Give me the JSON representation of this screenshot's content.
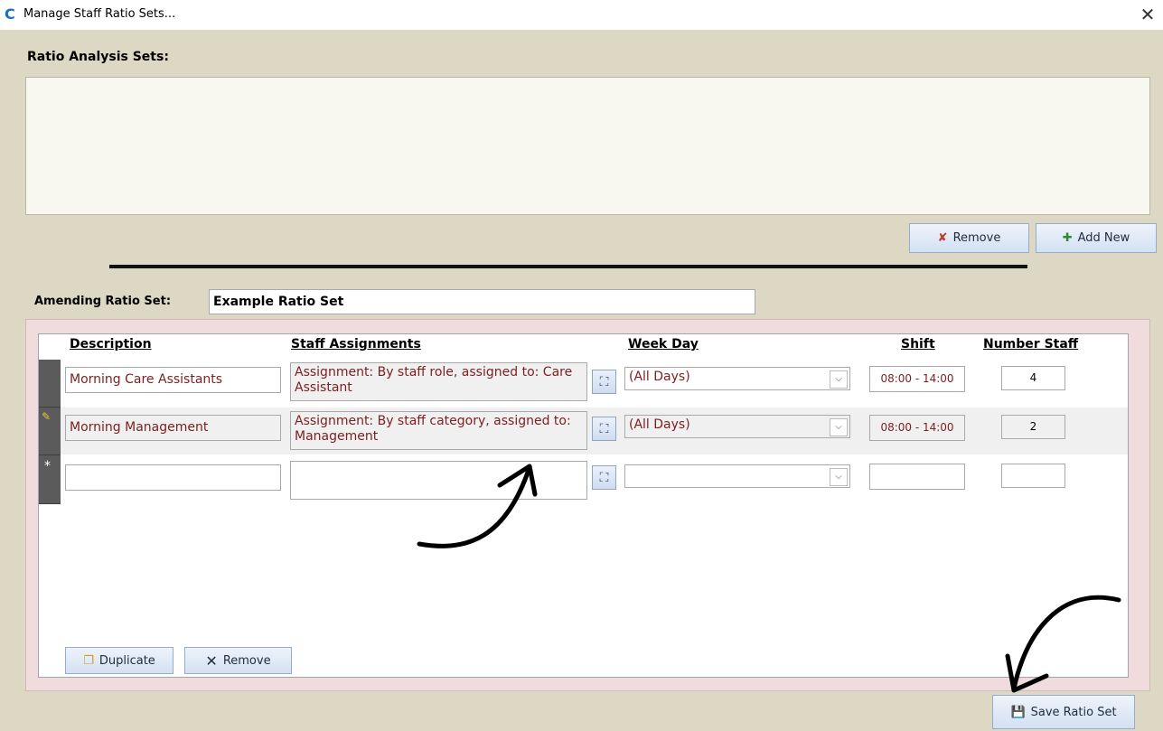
{
  "window": {
    "logo_text": "C",
    "title": "Manage Staff Ratio Sets...",
    "close_symbol": "✕"
  },
  "sets": {
    "label": "Ratio Analysis Sets:",
    "remove_label": "Remove",
    "add_label": "Add New"
  },
  "amending": {
    "label": "Amending Ratio Set:",
    "name_value": "Example Ratio Set"
  },
  "grid": {
    "headers": {
      "description": "Description",
      "staff": "Staff Assignments",
      "week": "Week Day",
      "shift": "Shift",
      "number": "Number Staff"
    },
    "rows": [
      {
        "description": "Morning Care Assistants",
        "staff": "Assignment: By staff role, assigned to: Care Assistant",
        "week": "(All Days)",
        "shift": "08:00 - 14:00",
        "number": "4"
      },
      {
        "description": "Morning Management",
        "staff": "Assignment: By staff category, assigned to: Management",
        "week": "(All Days)",
        "shift": "08:00 - 14:00",
        "number": "2"
      },
      {
        "description": "",
        "staff": "",
        "week": "",
        "shift": "",
        "number": ""
      }
    ],
    "duplicate_label": "Duplicate",
    "remove_label": "Remove"
  },
  "save_label": "Save Ratio Set",
  "icons": {
    "remove": "remove-icon",
    "add": "add-icon",
    "picker": "picker-icon",
    "duplicate": "duplicate-icon",
    "close": "close-icon",
    "save": "floppy-disk-icon",
    "edit": "pencil-icon",
    "new_row": "asterisk-icon"
  },
  "colors": {
    "background": "#ddd8c3",
    "subform_border": "#f0dcdc",
    "field_text": "#7b1f1f",
    "button": "#d4e1f2"
  }
}
